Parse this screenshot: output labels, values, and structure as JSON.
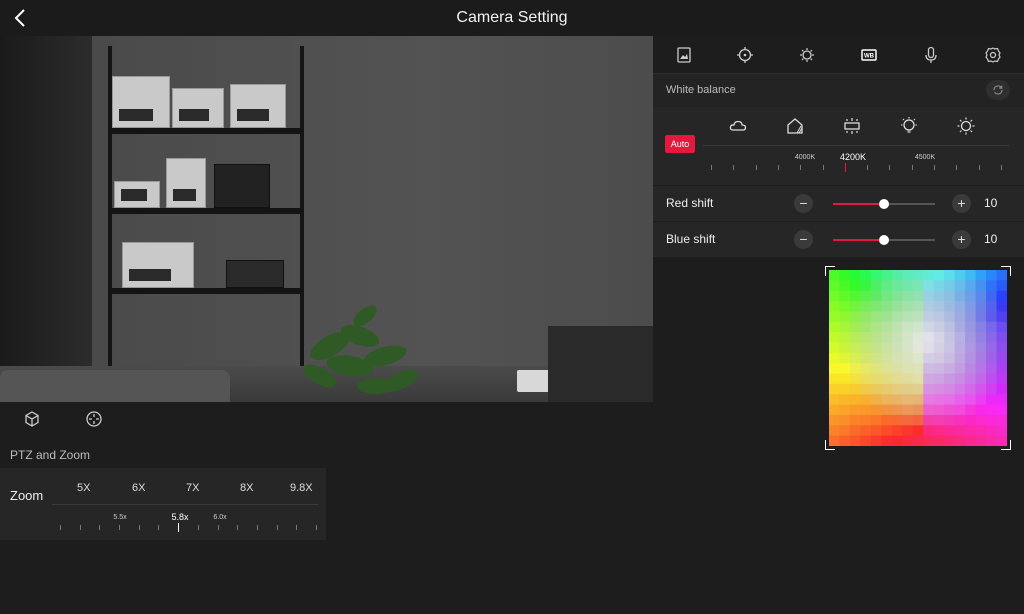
{
  "header": {
    "title": "Camera Setting",
    "back_icon": "chevron-left-icon"
  },
  "preview_tools": [
    {
      "name": "cube-icon"
    },
    {
      "name": "ptz-crosshair-icon"
    }
  ],
  "ptz": {
    "section_label": "PTZ and Zoom",
    "zoom_label": "Zoom",
    "presets": [
      "5X",
      "6X",
      "7X",
      "8X",
      "9.8X"
    ],
    "tick_labels": [
      "5.5x",
      "5.8x",
      "6.0x"
    ],
    "current_index": 1
  },
  "tabs": [
    {
      "name": "image-icon"
    },
    {
      "name": "focus-icon"
    },
    {
      "name": "exposure-icon"
    },
    {
      "name": "white-balance-icon",
      "active": true
    },
    {
      "name": "microphone-icon"
    },
    {
      "name": "gear-icon"
    }
  ],
  "white_balance": {
    "title": "White balance",
    "refresh_icon": "refresh-icon",
    "auto_label": "Auto",
    "presets": [
      "cloudy-icon",
      "shade-icon",
      "fluorescent-icon",
      "incandescent-icon",
      "daylight-icon"
    ],
    "kelvin_labels": [
      "4000K",
      "4200K",
      "4500K"
    ],
    "current_index": 1,
    "accent": "#e5193e"
  },
  "red_shift": {
    "label": "Red shift",
    "value": "10",
    "fraction": 0.5
  },
  "blue_shift": {
    "label": "Blue shift",
    "value": "10",
    "fraction": 0.5
  }
}
